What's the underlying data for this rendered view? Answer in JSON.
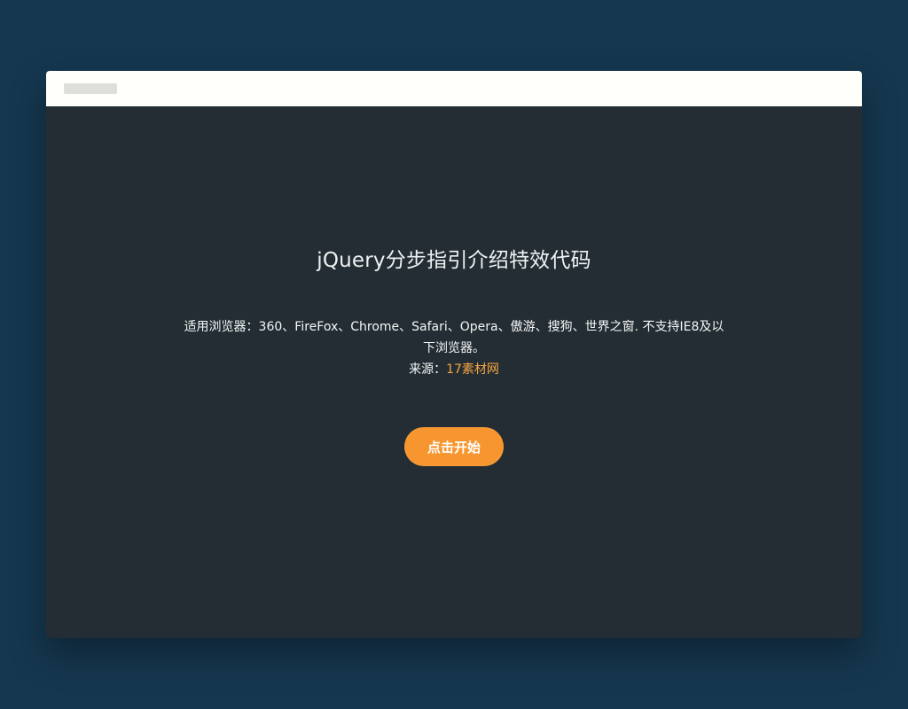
{
  "page": {
    "title": "jQuery分步指引介绍特效代码",
    "compatibility_text": "适用浏览器：360、FireFox、Chrome、Safari、Opera、傲游、搜狗、世界之窗. 不支持IE8及以下浏览器。",
    "source_prefix": "来源：",
    "source_link": "17素材网",
    "start_button": "点击开始"
  },
  "colors": {
    "background": "#15374f",
    "window_body": "#232d33",
    "titlebar": "#fffffb",
    "accent": "#f7962e",
    "link": "#f7a542"
  }
}
